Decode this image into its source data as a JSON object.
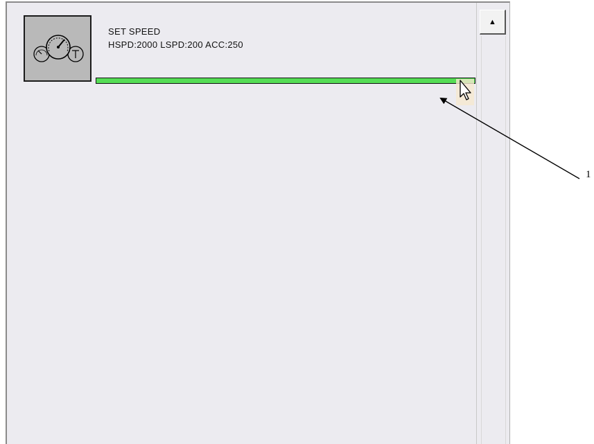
{
  "item": {
    "icon": "speed-gauges-icon",
    "title": "SET SPEED",
    "detail": "HSPD:2000 LSPD:200 ACC:250",
    "progress_fraction": 1.0,
    "progress_color": "#55dd55"
  },
  "scrollbar": {
    "up_icon": "triangle-up-icon",
    "up_glyph": "▲"
  },
  "annotation": {
    "label": "1"
  }
}
